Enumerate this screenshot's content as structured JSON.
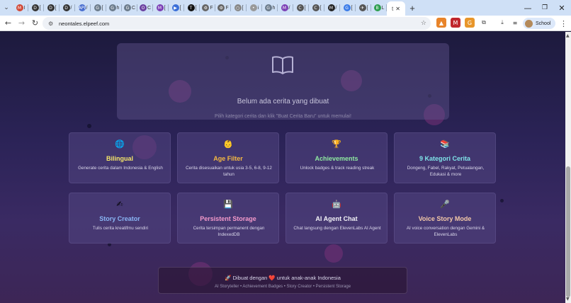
{
  "browser": {
    "tabs": [
      {
        "icon": "gmail-icon",
        "glyph": "M",
        "label": "I",
        "color": "#d14836"
      },
      {
        "icon": "site-d-icon",
        "glyph": "D",
        "label": "[",
        "color": "#333333"
      },
      {
        "icon": "site-d-icon",
        "glyph": "D",
        "label": "[",
        "color": "#333333"
      },
      {
        "icon": "site-d-icon",
        "glyph": "D",
        "label": "/",
        "color": "#333333"
      },
      {
        "icon": "api-icon",
        "glyph": "API",
        "label": "/",
        "color": "#4a6fd0"
      },
      {
        "icon": "site-g-icon",
        "glyph": "G",
        "label": "[",
        "color": "#6c7c8c"
      },
      {
        "icon": "site-g-icon",
        "glyph": "G",
        "label": "h",
        "color": "#6c7c8c"
      },
      {
        "icon": "site-g-icon",
        "glyph": "G",
        "label": "C",
        "color": "#6c7c8c"
      },
      {
        "icon": "site-circle-icon",
        "glyph": "O",
        "label": "C",
        "color": "#6a3fa0"
      },
      {
        "icon": "site-m-icon",
        "glyph": "M",
        "label": "[",
        "color": "#7b3fb5"
      },
      {
        "icon": "send-icon",
        "glyph": "▶",
        "label": "[",
        "color": "#3a6fd8"
      },
      {
        "icon": "terminal-icon",
        "glyph": "T",
        "label": "[",
        "color": "#111111"
      },
      {
        "icon": "gear-tab-icon",
        "glyph": "⚙",
        "label": "F",
        "color": "#666666"
      },
      {
        "icon": "gear-tab-icon",
        "glyph": "⚙",
        "label": "F",
        "color": "#666666"
      },
      {
        "icon": "site-circle-icon",
        "glyph": "○",
        "label": "[",
        "color": "#888888"
      },
      {
        "icon": "site-dot-icon",
        "glyph": "•",
        "label": "i",
        "color": "#999999"
      },
      {
        "icon": "site-g-icon",
        "glyph": "G",
        "label": "h",
        "color": "#6c7c8c"
      },
      {
        "icon": "site-m-icon",
        "glyph": "M",
        "label": "/",
        "color": "#7b3fb5"
      },
      {
        "icon": "site-c-icon",
        "glyph": "C",
        "label": "[",
        "color": "#555555"
      },
      {
        "icon": "site-c-icon",
        "glyph": "C",
        "label": "[",
        "color": "#555555"
      },
      {
        "icon": "site-m-icon",
        "glyph": "M",
        "label": "/",
        "color": "#222222"
      },
      {
        "icon": "translate-icon",
        "glyph": "G",
        "label": "[",
        "color": "#3a7be8"
      },
      {
        "icon": "plane-icon",
        "glyph": "✈",
        "label": "[",
        "color": "#555555"
      },
      {
        "icon": "site-b-icon",
        "glyph": "B",
        "label": "L",
        "color": "#2e9e4f"
      }
    ],
    "active_tab": {
      "glyph": "t",
      "close": "✕"
    },
    "new_tab": "+",
    "window": {
      "minimize": "—",
      "maximize": "❐",
      "close": "✕"
    },
    "url": "neontales.elpeef.com",
    "profile_label": "School"
  },
  "empty_state": {
    "title": "Belum ada cerita yang dibuat",
    "subtitle": "Pilih kategori cerita dan klik \"Buat Cerita Baru\" untuk memulai!"
  },
  "features": [
    {
      "icon": "🌐",
      "icon_name": "globe-icon",
      "title": "Bilingual",
      "desc": "Generate cerita dalam Indonesia & English",
      "color": "#f5e66a"
    },
    {
      "icon": "👶",
      "icon_name": "baby-icon",
      "title": "Age Filter",
      "desc": "Cerita disesuaikan untuk usia 3-5, 6-8, 9-12 tahun",
      "color": "#f5b942"
    },
    {
      "icon": "🏆",
      "icon_name": "trophy-icon",
      "title": "Achievements",
      "desc": "Unlock badges & track reading streak",
      "color": "#8ee8a0"
    },
    {
      "icon": "📚",
      "icon_name": "books-icon",
      "title": "9 Kategori Cerita",
      "desc": "Dongeng, Fabel, Rakyat, Petualangan, Edukasi & more",
      "color": "#7fe3e8"
    },
    {
      "icon": "✍",
      "icon_name": "writing-hand-icon",
      "title": "Story Creator",
      "desc": "Tulis cerita kreatifmu sendiri",
      "color": "#8ab6f5"
    },
    {
      "icon": "💾",
      "icon_name": "floppy-disk-icon",
      "title": "Persistent Storage",
      "desc": "Cerita tersimpan permanent dengan IndexedDB",
      "color": "#f59acb"
    },
    {
      "icon": "🤖",
      "icon_name": "robot-icon",
      "title": "AI Agent Chat",
      "desc": "Chat langsung dengan ElevenLabs AI Agent",
      "color": "#f3f3f7"
    },
    {
      "icon": "🎤",
      "icon_name": "microphone-icon",
      "title": "Voice Story Mode",
      "desc": "AI voice conversation dengan Gemini & ElevenLabs",
      "color": "#f4c9a8"
    }
  ],
  "footer": {
    "line1": "🚀 Dibuat dengan ❤️ untuk anak-anak Indonesia",
    "line2": "AI Storyteller • Achievement Badges • Story Creator • Persistent Storage"
  }
}
